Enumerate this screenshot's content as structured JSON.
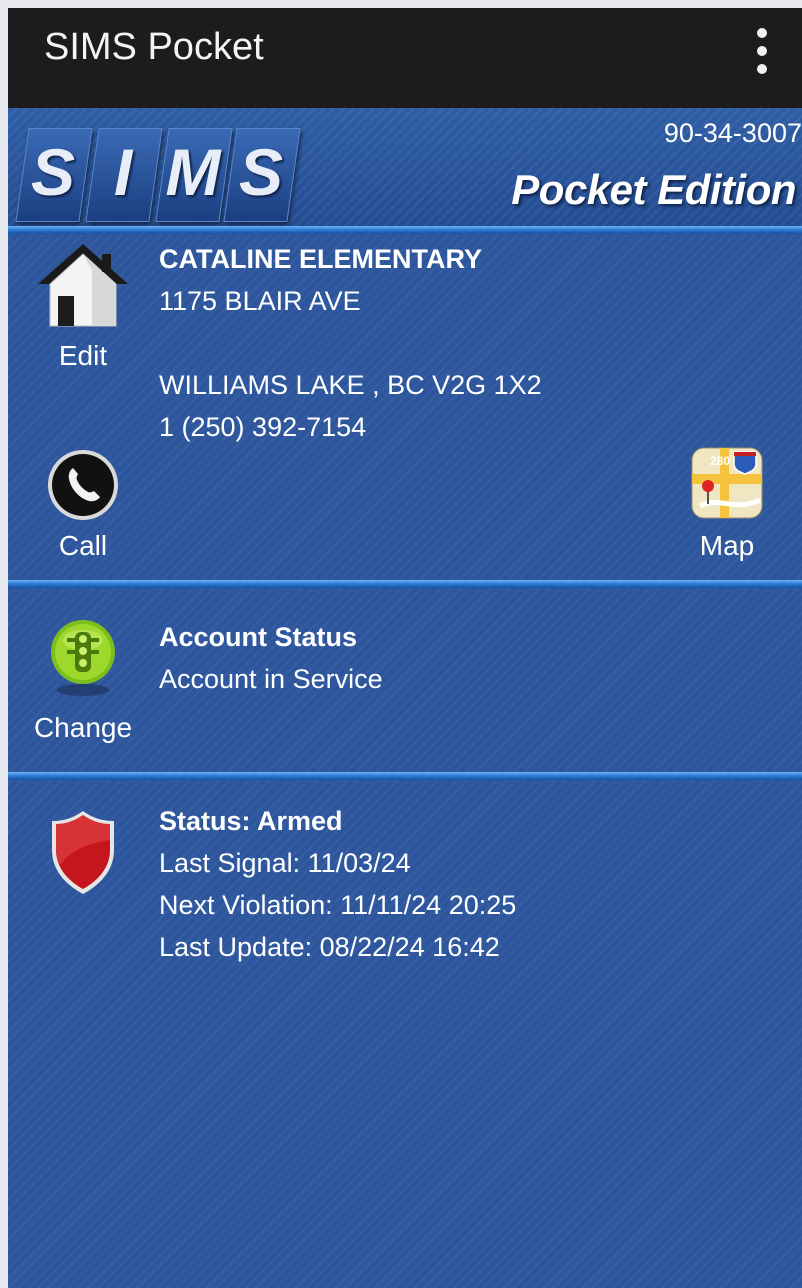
{
  "actionbar": {
    "title": "SIMS Pocket",
    "menu_icon": "overflow-menu-icon"
  },
  "banner": {
    "logo_letters": [
      "S",
      "I",
      "M",
      "S"
    ],
    "account_number": "90-34-3007",
    "edition": "Pocket Edition"
  },
  "site": {
    "name": "CATALINE ELEMENTARY",
    "address1": "1175 BLAIR AVE",
    "city_line": "WILLIAMS LAKE , BC V2G 1X2",
    "phone": "1 (250) 392-7154",
    "edit_label": "Edit",
    "call_label": "Call",
    "map_label": "Map",
    "map_badge": "280",
    "icons": {
      "edit": "house-icon",
      "call": "phone-icon",
      "map": "map-icon"
    }
  },
  "account": {
    "heading": "Account Status",
    "value": "Account in Service",
    "change_label": "Change",
    "icon": "traffic-light-icon"
  },
  "alarm": {
    "status": "Status: Armed",
    "last_signal": "Last Signal: 11/03/24",
    "next_violation": "Next Violation: 11/11/24 20:25",
    "last_update": "Last Update: 08/22/24 16:42",
    "icon": "shield-icon",
    "shield_color": "#c4161c"
  },
  "colors": {
    "background": "#2d569d",
    "actionbar": "#1c1c1c",
    "divider": "#3b8ae0"
  }
}
